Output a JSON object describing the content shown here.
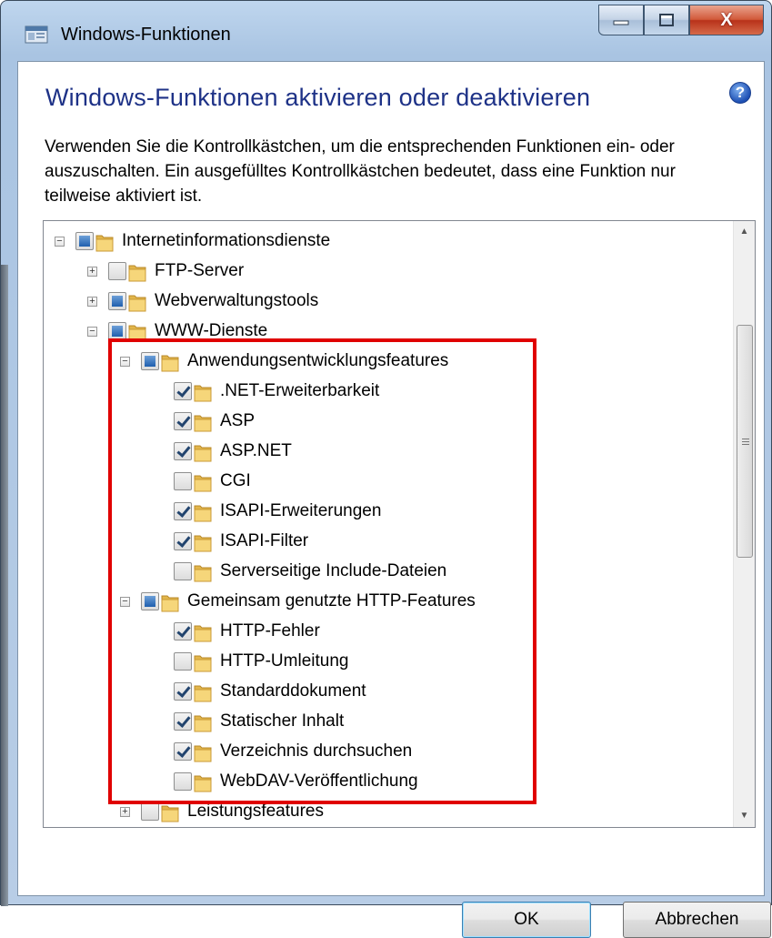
{
  "window": {
    "title": "Windows-Funktionen",
    "minimize_icon": "minimize-icon",
    "maximize_icon": "maximize-icon",
    "close_icon": "close-icon",
    "close_glyph": "X"
  },
  "dialog": {
    "heading": "Windows-Funktionen aktivieren oder deaktivieren",
    "help_glyph": "?",
    "description": "Verwenden Sie die Kontrollkästchen, um die entsprechenden Funktionen ein- oder auszuschalten. Ein ausgefülltes Kontrollkästchen bedeutet, dass eine Funktion nur teilweise aktiviert ist."
  },
  "tree": {
    "items": [
      {
        "label": "Internetinformationsdienste",
        "level": 0,
        "expander": "collapse",
        "state": "partial"
      },
      {
        "label": "FTP-Server",
        "level": 1,
        "expander": "expand",
        "state": "unchecked"
      },
      {
        "label": "Webverwaltungstools",
        "level": 1,
        "expander": "expand",
        "state": "partial"
      },
      {
        "label": "WWW-Dienste",
        "level": 1,
        "expander": "collapse",
        "state": "partial"
      },
      {
        "label": "Anwendungsentwicklungsfeatures",
        "level": 2,
        "expander": "collapse",
        "state": "partial"
      },
      {
        "label": ".NET-Erweiterbarkeit",
        "level": 3,
        "expander": "",
        "state": "checked"
      },
      {
        "label": "ASP",
        "level": 3,
        "expander": "",
        "state": "checked"
      },
      {
        "label": "ASP.NET",
        "level": 3,
        "expander": "",
        "state": "checked"
      },
      {
        "label": "CGI",
        "level": 3,
        "expander": "",
        "state": "unchecked"
      },
      {
        "label": "ISAPI-Erweiterungen",
        "level": 3,
        "expander": "",
        "state": "checked"
      },
      {
        "label": "ISAPI-Filter",
        "level": 3,
        "expander": "",
        "state": "checked"
      },
      {
        "label": "Serverseitige Include-Dateien",
        "level": 3,
        "expander": "",
        "state": "unchecked"
      },
      {
        "label": "Gemeinsam genutzte HTTP-Features",
        "level": 2,
        "expander": "collapse",
        "state": "partial"
      },
      {
        "label": "HTTP-Fehler",
        "level": 3,
        "expander": "",
        "state": "checked"
      },
      {
        "label": "HTTP-Umleitung",
        "level": 3,
        "expander": "",
        "state": "unchecked"
      },
      {
        "label": "Standarddokument",
        "level": 3,
        "expander": "",
        "state": "checked"
      },
      {
        "label": "Statischer Inhalt",
        "level": 3,
        "expander": "",
        "state": "checked"
      },
      {
        "label": "Verzeichnis durchsuchen",
        "level": 3,
        "expander": "",
        "state": "checked"
      },
      {
        "label": "WebDAV-Veröffentlichung",
        "level": 3,
        "expander": "",
        "state": "unchecked"
      },
      {
        "label": "Leistungsfeatures",
        "level": 2,
        "expander": "expand",
        "state": "unchecked"
      }
    ]
  },
  "buttons": {
    "ok": "OK",
    "cancel": "Abbrechen"
  },
  "colors": {
    "heading": "#1e3287",
    "highlight": "#e00000"
  }
}
